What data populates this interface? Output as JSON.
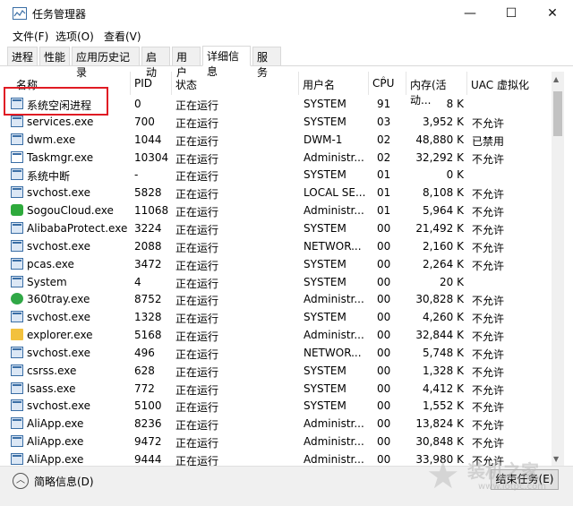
{
  "window": {
    "title": "任务管理器",
    "minimize_icon": "—",
    "maximize_icon": "☐",
    "close_icon": "✕"
  },
  "menu": {
    "file": "文件(F)",
    "options": "选项(O)",
    "view": "查看(V)"
  },
  "tabs": [
    "进程",
    "性能",
    "应用历史记录",
    "启动",
    "用户",
    "详细信息",
    "服务"
  ],
  "active_tab": "详细信息",
  "columns": {
    "name": "名称",
    "pid": "PID",
    "status": "状态",
    "user": "用户名",
    "cpu": "CPU",
    "memory": "内存(活动...",
    "uac": "UAC 虚拟化"
  },
  "rows": [
    {
      "name": "系统空闲进程",
      "pid": "0",
      "status": "正在运行",
      "user": "SYSTEM",
      "cpu": "91",
      "mem": "8 K",
      "uac": "",
      "icon": "process-window-icon"
    },
    {
      "name": "services.exe",
      "pid": "700",
      "status": "正在运行",
      "user": "SYSTEM",
      "cpu": "03",
      "mem": "3,952 K",
      "uac": "不允许",
      "icon": "process-window-icon"
    },
    {
      "name": "dwm.exe",
      "pid": "1044",
      "status": "正在运行",
      "user": "DWM-1",
      "cpu": "02",
      "mem": "48,880 K",
      "uac": "已禁用",
      "icon": "process-window-icon"
    },
    {
      "name": "Taskmgr.exe",
      "pid": "10304",
      "status": "正在运行",
      "user": "Administr...",
      "cpu": "02",
      "mem": "32,292 K",
      "uac": "不允许",
      "icon": "taskmgr-icon"
    },
    {
      "name": "系统中断",
      "pid": "-",
      "status": "正在运行",
      "user": "SYSTEM",
      "cpu": "01",
      "mem": "0 K",
      "uac": "",
      "icon": "process-window-icon"
    },
    {
      "name": "svchost.exe",
      "pid": "5828",
      "status": "正在运行",
      "user": "LOCAL SE...",
      "cpu": "01",
      "mem": "8,108 K",
      "uac": "不允许",
      "icon": "process-window-icon"
    },
    {
      "name": "SogouCloud.exe",
      "pid": "11068",
      "status": "正在运行",
      "user": "Administr...",
      "cpu": "01",
      "mem": "5,964 K",
      "uac": "不允许",
      "icon": "sogou-icon"
    },
    {
      "name": "AlibabaProtect.exe",
      "pid": "3224",
      "status": "正在运行",
      "user": "SYSTEM",
      "cpu": "00",
      "mem": "21,492 K",
      "uac": "不允许",
      "icon": "process-window-icon"
    },
    {
      "name": "svchost.exe",
      "pid": "2088",
      "status": "正在运行",
      "user": "NETWOR...",
      "cpu": "00",
      "mem": "2,160 K",
      "uac": "不允许",
      "icon": "process-window-icon"
    },
    {
      "name": "pcas.exe",
      "pid": "3472",
      "status": "正在运行",
      "user": "SYSTEM",
      "cpu": "00",
      "mem": "2,264 K",
      "uac": "不允许",
      "icon": "process-window-icon"
    },
    {
      "name": "System",
      "pid": "4",
      "status": "正在运行",
      "user": "SYSTEM",
      "cpu": "00",
      "mem": "20 K",
      "uac": "",
      "icon": "process-window-icon"
    },
    {
      "name": "360tray.exe",
      "pid": "8752",
      "status": "正在运行",
      "user": "Administr...",
      "cpu": "00",
      "mem": "30,828 K",
      "uac": "不允许",
      "icon": "360-icon"
    },
    {
      "name": "svchost.exe",
      "pid": "1328",
      "status": "正在运行",
      "user": "SYSTEM",
      "cpu": "00",
      "mem": "4,260 K",
      "uac": "不允许",
      "icon": "process-window-icon"
    },
    {
      "name": "explorer.exe",
      "pid": "5168",
      "status": "正在运行",
      "user": "Administr...",
      "cpu": "00",
      "mem": "32,844 K",
      "uac": "不允许",
      "icon": "folder-icon"
    },
    {
      "name": "svchost.exe",
      "pid": "496",
      "status": "正在运行",
      "user": "NETWOR...",
      "cpu": "00",
      "mem": "5,748 K",
      "uac": "不允许",
      "icon": "process-window-icon"
    },
    {
      "name": "csrss.exe",
      "pid": "628",
      "status": "正在运行",
      "user": "SYSTEM",
      "cpu": "00",
      "mem": "1,328 K",
      "uac": "不允许",
      "icon": "process-window-icon"
    },
    {
      "name": "lsass.exe",
      "pid": "772",
      "status": "正在运行",
      "user": "SYSTEM",
      "cpu": "00",
      "mem": "4,412 K",
      "uac": "不允许",
      "icon": "process-window-icon"
    },
    {
      "name": "svchost.exe",
      "pid": "5100",
      "status": "正在运行",
      "user": "SYSTEM",
      "cpu": "00",
      "mem": "1,552 K",
      "uac": "不允许",
      "icon": "process-window-icon"
    },
    {
      "name": "AliApp.exe",
      "pid": "8236",
      "status": "正在运行",
      "user": "Administr...",
      "cpu": "00",
      "mem": "13,824 K",
      "uac": "不允许",
      "icon": "process-window-icon"
    },
    {
      "name": "AliApp.exe",
      "pid": "9472",
      "status": "正在运行",
      "user": "Administr...",
      "cpu": "00",
      "mem": "30,848 K",
      "uac": "不允许",
      "icon": "process-window-icon"
    },
    {
      "name": "AliApp.exe",
      "pid": "9444",
      "status": "正在运行",
      "user": "Administr...",
      "cpu": "00",
      "mem": "33,980 K",
      "uac": "不允许",
      "icon": "process-window-icon"
    }
  ],
  "footer": {
    "fewer_details": "简略信息(D)",
    "end_task": "结束任务(E)"
  },
  "watermark": {
    "text": "装机之家",
    "url": "www.lotpc.com"
  },
  "colors": {
    "highlight_border": "#e01b24",
    "accent": "#3a6ea5"
  }
}
